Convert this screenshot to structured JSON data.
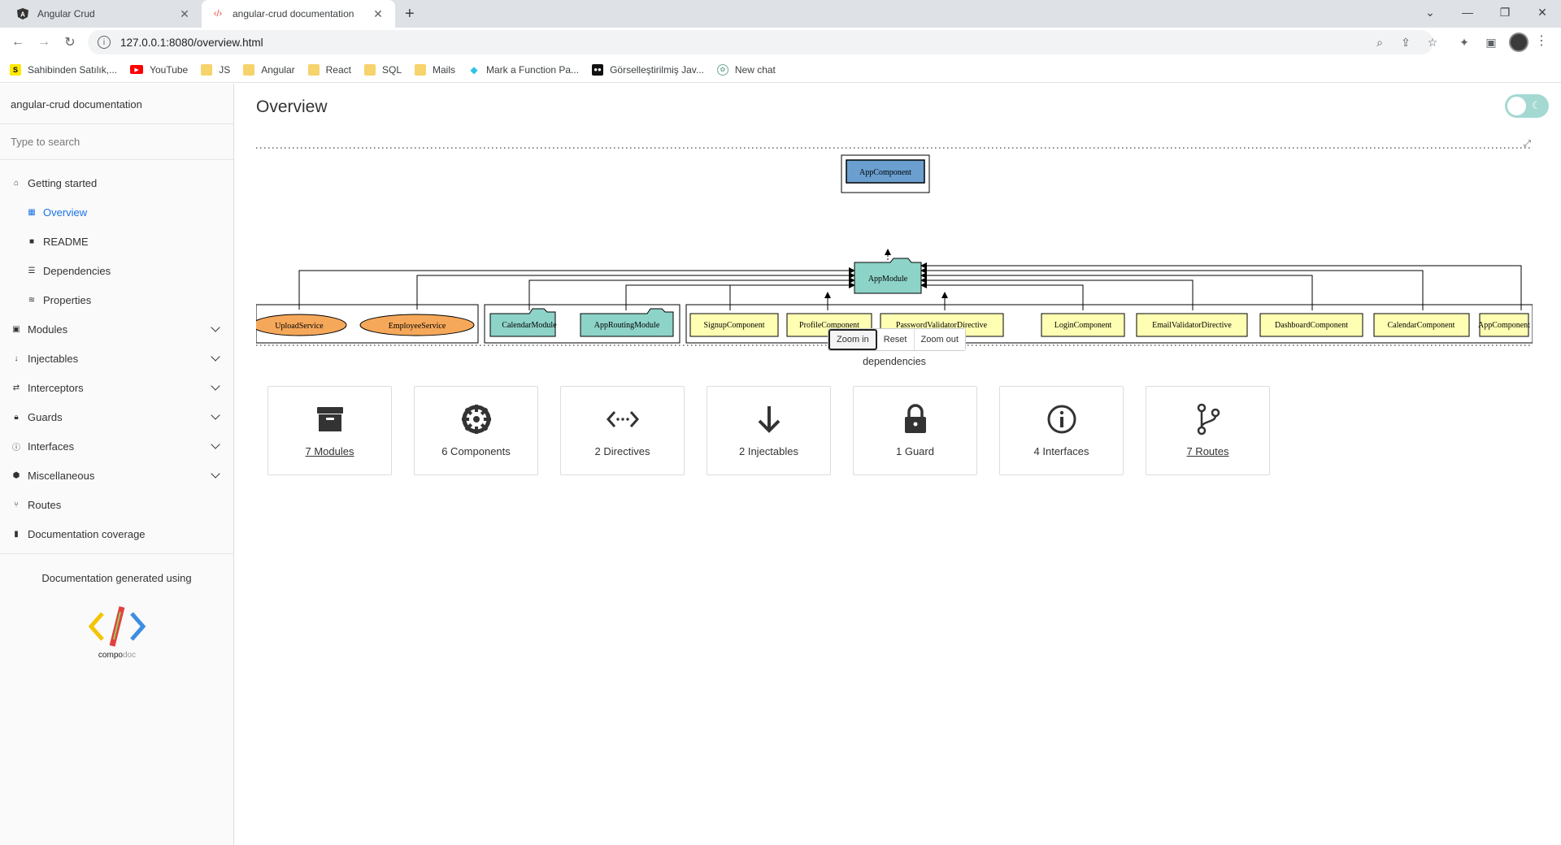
{
  "browser": {
    "tabs": [
      {
        "title": "Angular Crud",
        "favicon": "angular-icon"
      },
      {
        "title": "angular-crud documentation",
        "favicon": "compodoc-icon"
      }
    ],
    "url": "127.0.0.1:8080/overview.html",
    "bookmarks": [
      {
        "label": "Sahibinden Satılık,...",
        "icon": "sahibinden-icon",
        "color": "#ffe800"
      },
      {
        "label": "YouTube",
        "icon": "youtube-icon",
        "color": "#ff0000"
      },
      {
        "label": "JS",
        "icon": "folder-icon"
      },
      {
        "label": "Angular",
        "icon": "folder-icon"
      },
      {
        "label": "React",
        "icon": "folder-icon"
      },
      {
        "label": "SQL",
        "icon": "folder-icon"
      },
      {
        "label": "Mails",
        "icon": "folder-icon"
      },
      {
        "label": "Mark a Function Pa...",
        "icon": "diamond-icon",
        "color": "#2ec4e8"
      },
      {
        "label": "Görselleştirilmiş Jav...",
        "icon": "pythontutor-icon"
      },
      {
        "label": "New chat",
        "icon": "chatgpt-icon"
      }
    ]
  },
  "sidebar": {
    "title": "angular-crud documentation",
    "search_placeholder": "Type to search",
    "items": [
      {
        "label": "Getting started",
        "icon": "home-icon",
        "level": 0,
        "expandable": false,
        "active": false
      },
      {
        "label": "Overview",
        "icon": "grid-icon",
        "level": 1,
        "expandable": false,
        "active": true
      },
      {
        "label": "README",
        "icon": "book-icon",
        "level": 1,
        "expandable": false,
        "active": false
      },
      {
        "label": "Dependencies",
        "icon": "list-icon",
        "level": 1,
        "expandable": false,
        "active": false
      },
      {
        "label": "Properties",
        "icon": "layers-icon",
        "level": 1,
        "expandable": false,
        "active": false
      },
      {
        "label": "Modules",
        "icon": "archive-icon",
        "level": 0,
        "expandable": true,
        "active": false
      },
      {
        "label": "Injectables",
        "icon": "arrow-down-icon",
        "level": 0,
        "expandable": true,
        "active": false
      },
      {
        "label": "Interceptors",
        "icon": "swap-icon",
        "level": 0,
        "expandable": true,
        "active": false
      },
      {
        "label": "Guards",
        "icon": "lock-icon",
        "level": 0,
        "expandable": true,
        "active": false
      },
      {
        "label": "Interfaces",
        "icon": "info-icon",
        "level": 0,
        "expandable": true,
        "active": false
      },
      {
        "label": "Miscellaneous",
        "icon": "cube-icon",
        "level": 0,
        "expandable": true,
        "active": false
      },
      {
        "label": "Routes",
        "icon": "fork-icon",
        "level": 0,
        "expandable": false,
        "active": false
      },
      {
        "label": "Documentation coverage",
        "icon": "chart-icon",
        "level": 0,
        "expandable": false,
        "active": false
      }
    ],
    "generated_text": "Documentation generated using",
    "logo_text_a": "compo",
    "logo_text_b": "doc"
  },
  "main": {
    "title": "Overview",
    "graph": {
      "root": "AppComponent",
      "module": "AppModule",
      "providers": [
        "UploadService",
        "EmployeeService"
      ],
      "imports": [
        "CalendarModule",
        "AppRoutingModule"
      ],
      "declarations": [
        "SignupComponent",
        "ProfileComponent",
        "PasswordValidatorDirective",
        "LoginComponent",
        "EmailValidatorDirective",
        "DashboardComponent",
        "CalendarComponent",
        "AppComponent"
      ],
      "caption": "dependencies",
      "colors": {
        "root": "#6a9fcf",
        "module": "#8dd3c7",
        "provider": "#f6a85a",
        "declaration": "#ffffb3"
      }
    },
    "zoom": {
      "in": "Zoom in",
      "reset": "Reset",
      "out": "Zoom out"
    },
    "cards": [
      {
        "label": "7 Modules",
        "icon": "archive-icon",
        "link": true
      },
      {
        "label": "6 Components",
        "icon": "gear-icon",
        "link": false
      },
      {
        "label": "2 Directives",
        "icon": "code-icon",
        "link": false
      },
      {
        "label": "2 Injectables",
        "icon": "arrow-down-icon",
        "link": false
      },
      {
        "label": "1 Guard",
        "icon": "lock-icon",
        "link": false
      },
      {
        "label": "4 Interfaces",
        "icon": "info-icon",
        "link": false
      },
      {
        "label": "7 Routes",
        "icon": "fork-icon",
        "link": true
      }
    ]
  }
}
